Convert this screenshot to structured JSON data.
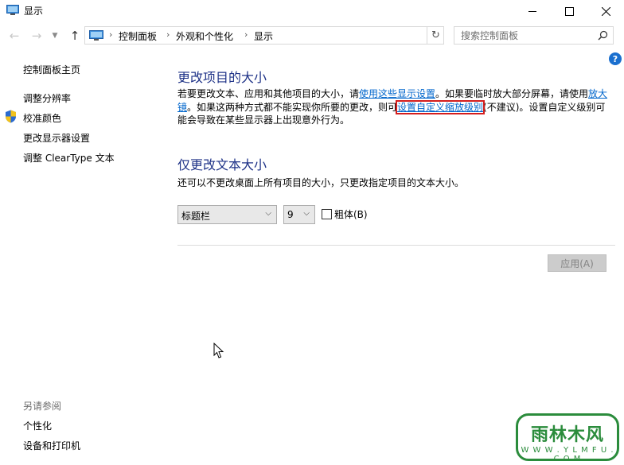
{
  "window": {
    "title": "显示"
  },
  "navigation": {
    "breadcrumbs": [
      "控制面板",
      "外观和个性化",
      "显示"
    ],
    "search_placeholder": "搜索控制面板"
  },
  "sidebar": {
    "home_link": "控制面板主页",
    "links": [
      "调整分辨率",
      "校准颜色",
      "更改显示器设置",
      "调整 ClearType 文本"
    ],
    "see_also_title": "另请参阅",
    "see_also_links": [
      "个性化",
      "设备和打印机"
    ]
  },
  "main": {
    "section1": {
      "title": "更改项目的大小",
      "text_1": "若要更改文本、应用和其他项目的大小，请",
      "link_1": "使用这些显示设置",
      "text_2": "。如果要临时放大部分屏幕，请使用",
      "link_2": "放大镜",
      "text_3": "。如果这两种方式都不能实现你所要的更改，则可",
      "link_3": "设置自定义缩放级别",
      "text_4": "(不建议)。设置自定义级别可能会导致在某些显示器上出现意外行为。"
    },
    "section2": {
      "title": "仅更改文本大小",
      "description": "还可以不更改桌面上所有项目的大小，只更改指定项目的文本大小。",
      "item_select": "标题栏",
      "size_select": "9",
      "bold_label": "粗体(B)",
      "bold_checked": false
    },
    "apply_button": "应用(A)"
  },
  "watermark": {
    "top": "雨林木风",
    "bottom": "W W W . Y L M F U . C O M"
  },
  "colors": {
    "heading": "#1e3287",
    "link": "#0066cc",
    "highlight_box": "#d41d1d"
  }
}
